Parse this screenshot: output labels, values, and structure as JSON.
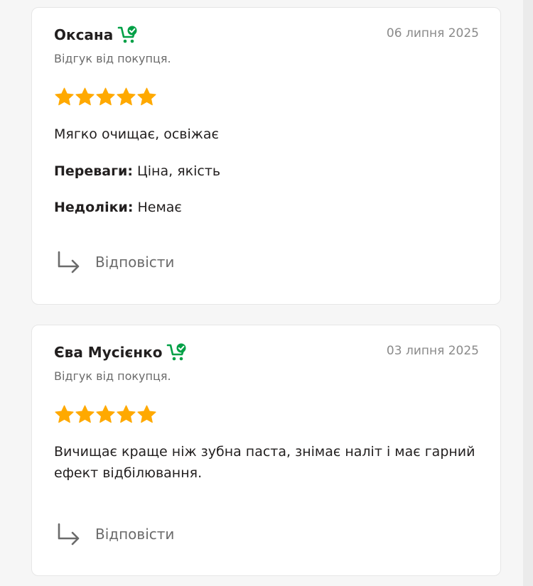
{
  "colors": {
    "star": "#ffa900",
    "buyer_icon": "#00a046",
    "reply_icon": "#6b6b6b"
  },
  "reviews": [
    {
      "author": "Оксана",
      "buyer_icon": "cart-check-icon",
      "date": "06 липня 2025",
      "badge": "Відгук від покупця.",
      "rating": 5,
      "text": "Мягко очищає, освіжає",
      "pros_label": "Переваги:",
      "pros": "Ціна, якість",
      "cons_label": "Недоліки:",
      "cons": "Немає",
      "reply_label": "Відповісти"
    },
    {
      "author": "Єва Мусієнко",
      "buyer_icon": "cart-check-icon",
      "date": "03 липня 2025",
      "badge": "Відгук від покупця.",
      "rating": 5,
      "text": "Вичищає краще ніж зубна паста, знімає наліт і має гарний ефект відбілювання.",
      "reply_label": "Відповісти"
    }
  ]
}
